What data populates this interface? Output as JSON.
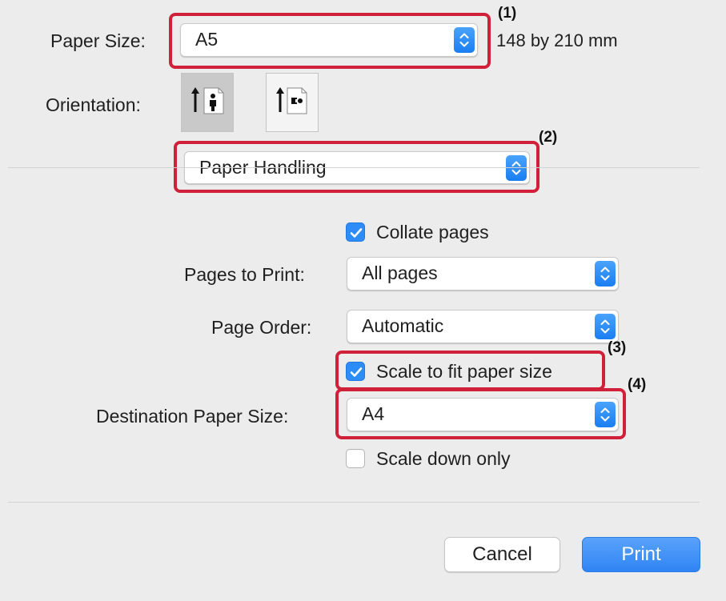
{
  "paper_size": {
    "label": "Paper Size:",
    "value": "A5",
    "dimensions": "148 by 210 mm"
  },
  "orientation": {
    "label": "Orientation:",
    "options": [
      "portrait-orientation-icon",
      "landscape-orientation-icon"
    ],
    "selected": "portrait"
  },
  "section_menu": {
    "value": "Paper Handling"
  },
  "collate": {
    "label": "Collate pages",
    "checked": true
  },
  "pages_to_print": {
    "label": "Pages to Print:",
    "value": "All pages"
  },
  "page_order": {
    "label": "Page Order:",
    "value": "Automatic"
  },
  "scale_to_fit": {
    "label": "Scale to fit paper size",
    "checked": true
  },
  "destination_paper_size": {
    "label": "Destination Paper Size:",
    "value": "A4"
  },
  "scale_down_only": {
    "label": "Scale down only",
    "checked": false
  },
  "buttons": {
    "cancel": "Cancel",
    "print": "Print"
  },
  "callouts": {
    "c1": "(1)",
    "c2": "(2)",
    "c3": "(3)",
    "c4": "(4)"
  },
  "colors": {
    "accent": "#2d8cf5",
    "print_button": "#3d8ef6",
    "callout_border": "#d0203a",
    "background": "#ececec"
  }
}
